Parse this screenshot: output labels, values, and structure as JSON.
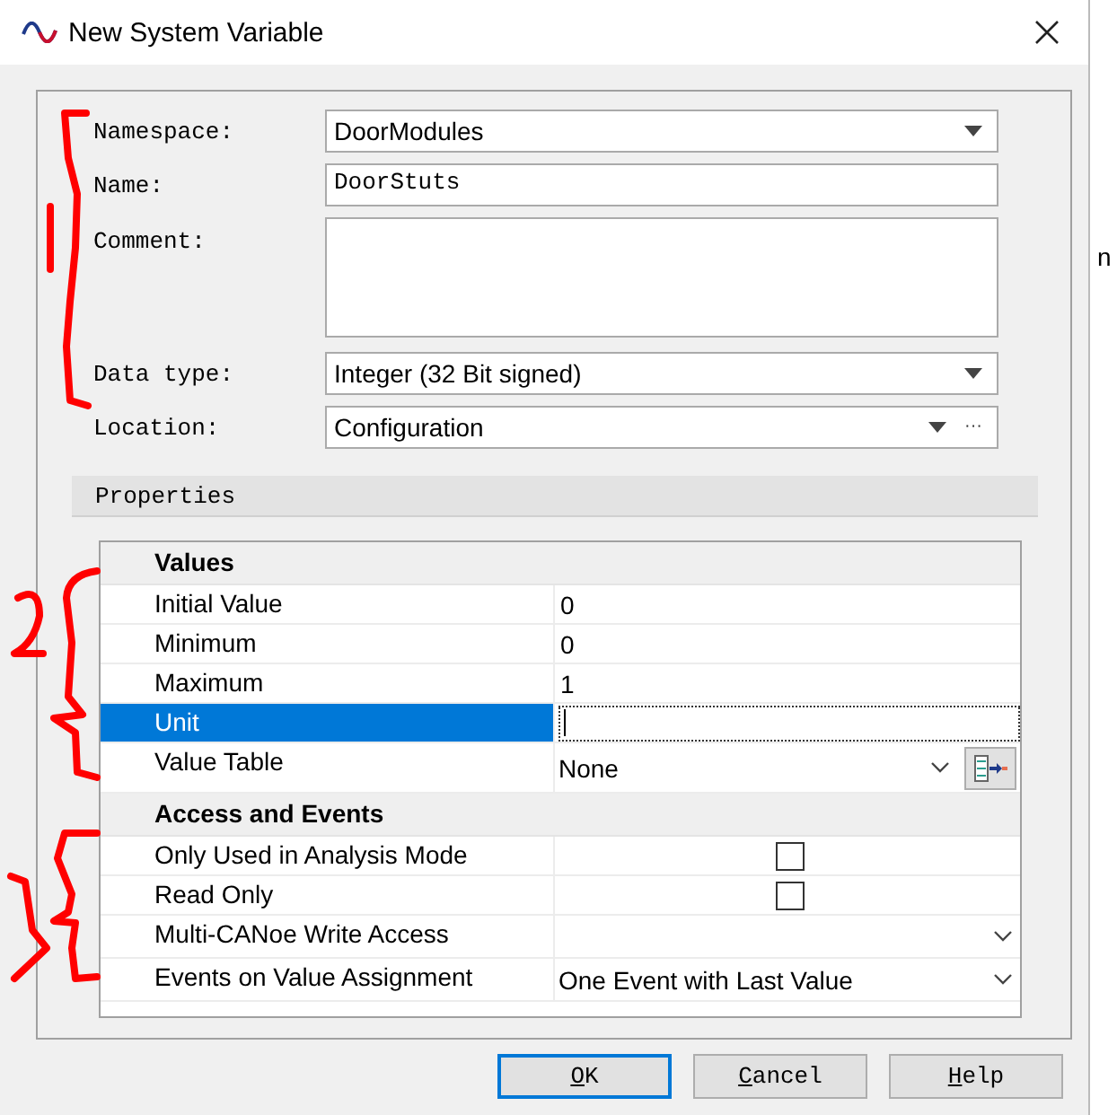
{
  "window": {
    "title": "New System Variable"
  },
  "fields": [
    {
      "kind": "combo",
      "label": "Namespace:",
      "value": "DoorModules"
    },
    {
      "kind": "text",
      "label": "Name:",
      "value": "DoorStuts"
    },
    {
      "kind": "textarea",
      "label": "Comment:"
    },
    {
      "kind": "combo",
      "label": "Data type:",
      "value": "Integer (32 Bit signed)"
    },
    {
      "kind": "combo_browse",
      "label": "Location:",
      "value": "Configuration",
      "browse": "···"
    }
  ],
  "properties": {
    "title": "Properties",
    "sections": [
      {
        "title": "Values",
        "rows": [
          {
            "kind": "text",
            "label": "Initial Value",
            "value": "0",
            "selected": false
          },
          {
            "kind": "text",
            "label": "Minimum",
            "value": "0",
            "selected": false
          },
          {
            "kind": "text",
            "label": "Maximum",
            "value": "1",
            "selected": false
          },
          {
            "kind": "edit",
            "label": "Unit",
            "selected": true
          },
          {
            "kind": "combo_button",
            "label": "Value Table",
            "value": "None",
            "selected": false
          }
        ]
      },
      {
        "title": "Access and Events",
        "rows": [
          {
            "kind": "checkbox",
            "label": "Only Used in Analysis Mode",
            "checked": false,
            "selected": false
          },
          {
            "kind": "checkbox",
            "label": "Read Only",
            "checked": false,
            "selected": false
          },
          {
            "kind": "combo",
            "label": "Multi-CANoe Write Access",
            "selected": false
          },
          {
            "kind": "combo",
            "label": "Events on Value Assignment",
            "value": "One Event with Last Value",
            "selected": false
          }
        ]
      }
    ]
  },
  "buttons": [
    {
      "label": "OK",
      "default": true
    },
    {
      "label": "Cancel",
      "default": false
    },
    {
      "label": "Help",
      "default": false
    }
  ],
  "background_text": "n"
}
